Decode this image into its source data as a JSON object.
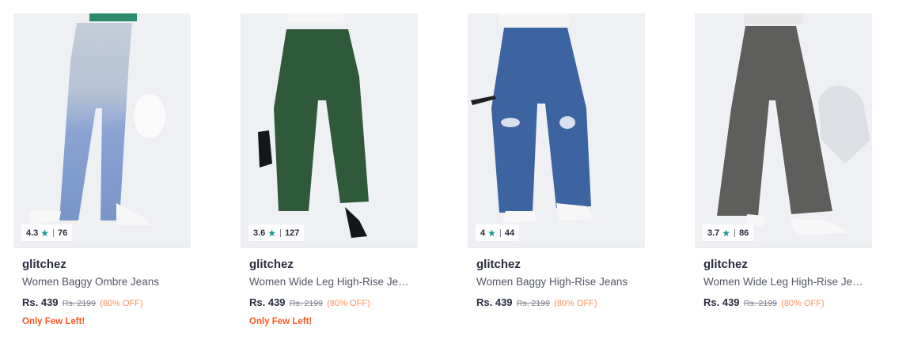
{
  "products": [
    {
      "rating": "4.3",
      "rating_count": "76",
      "brand": "glitchez",
      "name": "Women Baggy Ombre Jeans",
      "price": "Rs. 439",
      "mrp": "Rs. 2199",
      "discount": "(80% OFF)",
      "stock_note": "Only Few Left!",
      "jeans_color": "#7f9ccf",
      "jeans_top_color": "#c3cdd9"
    },
    {
      "rating": "3.6",
      "rating_count": "127",
      "brand": "glitchez",
      "name": "Women Wide Leg High-Rise Jeans",
      "price": "Rs. 439",
      "mrp": "Rs. 2199",
      "discount": "(80% OFF)",
      "stock_note": "Only Few Left!",
      "jeans_color": "#2f5a3a",
      "jeans_top_color": "#2f5a3a"
    },
    {
      "rating": "4",
      "rating_count": "44",
      "brand": "glitchez",
      "name": "Women Baggy High-Rise Jeans",
      "price": "Rs. 439",
      "mrp": "Rs. 2199",
      "discount": "(80% OFF)",
      "stock_note": "",
      "jeans_color": "#3d63a0",
      "jeans_top_color": "#3d63a0"
    },
    {
      "rating": "3.7",
      "rating_count": "86",
      "brand": "glitchez",
      "name": "Women Wide Leg High-Rise Jeans",
      "price": "Rs. 439",
      "mrp": "Rs. 2199",
      "discount": "(80% OFF)",
      "stock_note": "",
      "jeans_color": "#5e5f5c",
      "jeans_top_color": "#5e5f5c"
    }
  ],
  "icons": {
    "rating_star": "star-icon"
  },
  "colors": {
    "rating_star": "#14958f",
    "discount": "#ff905a",
    "stock_note": "#ff5722"
  }
}
